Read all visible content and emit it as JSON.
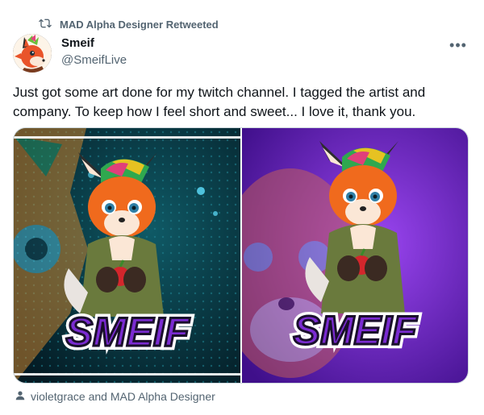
{
  "retweet": {
    "label": "MAD Alpha Designer Retweeted",
    "icon": "retweet-icon"
  },
  "author": {
    "display_name": "Smeif",
    "handle": "@SmeifLive",
    "avatar_icon": "fox-avatar"
  },
  "more_label": "•••",
  "tweet": {
    "text": "Just got some art done for my twitch channel. I tagged the artist and company. To keep how I feel short and sweet... I love it, thank you."
  },
  "media": {
    "images": [
      {
        "logo_text": "SMEIF",
        "background": "teal-bokeh"
      },
      {
        "logo_text": "SMEIF",
        "background": "purple"
      }
    ]
  },
  "tagged": {
    "text": "violetgrace and MAD Alpha Designer",
    "icon": "person-icon"
  },
  "colors": {
    "text_primary": "#0f1419",
    "text_secondary": "#536471",
    "purple_bg": "#7b2fd6",
    "teal_bg": "#0a3a45",
    "fox_orange": "#f06a1d"
  }
}
